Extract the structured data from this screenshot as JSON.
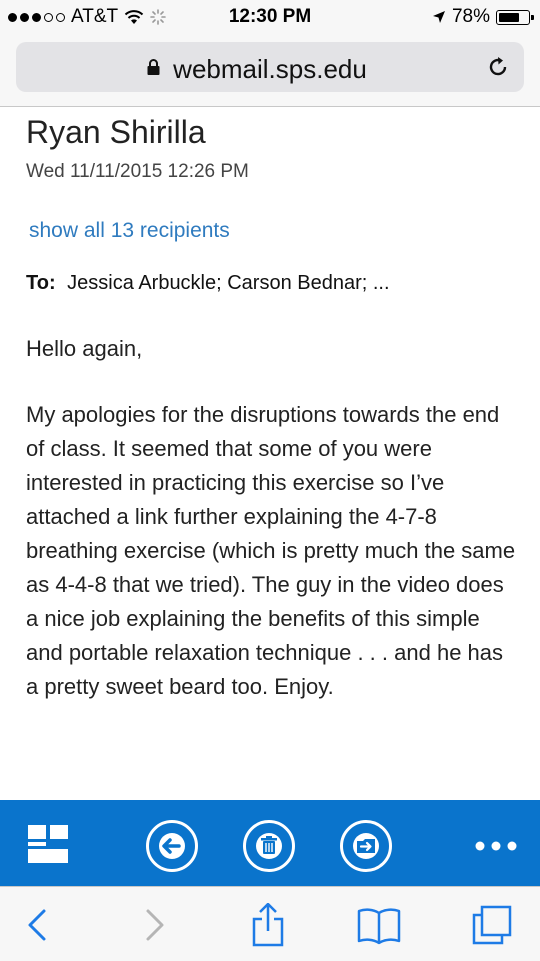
{
  "status_bar": {
    "carrier": "AT&T",
    "time": "12:30 PM",
    "battery": "78%",
    "battery_level": 0.78
  },
  "browser": {
    "url": "webmail.sps.edu"
  },
  "email": {
    "sender": "Ryan Shirilla",
    "date": "Wed 11/11/2015 12:26 PM",
    "recipients_link": "show all 13 recipients",
    "to_label": "To:",
    "to_recipients": "Jessica Arbuckle;  Carson Bednar;  ...",
    "greeting": "Hello again,",
    "body": "My apologies for the disruptions towards the end of class. It seemed that some of you were interested in practicing this exercise so I’ve attached a link further explaining the 4-7-8 breathing exercise (which is pretty much the same as 4-4-8 that we tried). The guy in the video does a nice job explaining the benefits of this simple and portable relaxation technique . . . and he has a pretty sweet beard too. Enjoy."
  },
  "colors": {
    "accent": "#0a74cc",
    "link": "#2f7bbf",
    "safari_blue": "#1e7be6"
  },
  "icons": {
    "action_bar": [
      "apps-grid-icon",
      "back-arrow-icon",
      "trash-icon",
      "move-folder-icon",
      "more-icon"
    ],
    "nav_bar": [
      "chevron-left-icon",
      "chevron-right-icon",
      "share-icon",
      "bookmarks-icon",
      "tabs-icon"
    ]
  }
}
